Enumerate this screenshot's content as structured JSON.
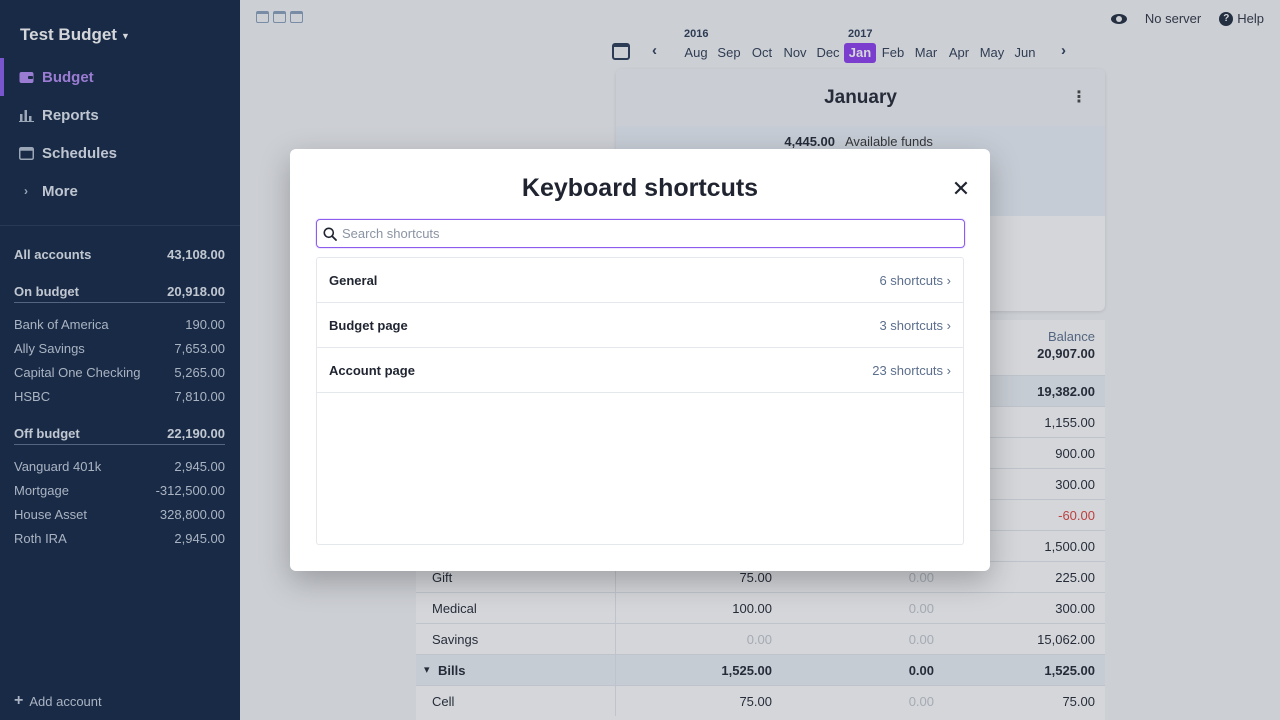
{
  "sidebar": {
    "budget_name": "Test Budget",
    "nav": [
      {
        "label": "Budget",
        "icon": "wallet-icon",
        "active": true
      },
      {
        "label": "Reports",
        "icon": "bar-chart-icon"
      },
      {
        "label": "Schedules",
        "icon": "calendar-icon"
      },
      {
        "label": "More",
        "icon": "chevron-right-icon"
      }
    ],
    "accounts": {
      "all": {
        "name": "All accounts",
        "amount": "43,108.00"
      },
      "on_budget": {
        "name": "On budget",
        "amount": "20,918.00"
      },
      "on_budget_items": [
        {
          "name": "Bank of America",
          "amount": "190.00"
        },
        {
          "name": "Ally Savings",
          "amount": "7,653.00"
        },
        {
          "name": "Capital One Checking",
          "amount": "5,265.00"
        },
        {
          "name": "HSBC",
          "amount": "7,810.00"
        }
      ],
      "off_budget": {
        "name": "Off budget",
        "amount": "22,190.00"
      },
      "off_budget_items": [
        {
          "name": "Vanguard 401k",
          "amount": "2,945.00"
        },
        {
          "name": "Mortgage",
          "amount": "-312,500.00"
        },
        {
          "name": "House Asset",
          "amount": "328,800.00"
        },
        {
          "name": "Roth IRA",
          "amount": "2,945.00"
        }
      ]
    },
    "add_account": "Add account"
  },
  "topbar": {
    "server": "No server",
    "help": "Help"
  },
  "months": {
    "year_2016": "2016",
    "year_2017": "2017",
    "labels": [
      "Aug",
      "Sep",
      "Oct",
      "Nov",
      "Dec",
      "Jan",
      "Feb",
      "Mar",
      "Apr",
      "May",
      "Jun"
    ],
    "selected_index": 5
  },
  "budget_card": {
    "title": "January",
    "available_funds_value": "4,445.00",
    "available_funds_label": "Available funds"
  },
  "table": {
    "balance_label": "Balance",
    "balance_total": "20,907.00",
    "rows": [
      {
        "name": "",
        "c1": "",
        "c2": "",
        "c3": "19,382.00",
        "group": true
      },
      {
        "name": "",
        "c1": "",
        "c2": "",
        "c3": "1,155.00"
      },
      {
        "name": "",
        "c1": "",
        "c2": "",
        "c3": "900.00"
      },
      {
        "name": "",
        "c1": "",
        "c2": "",
        "c3": "300.00"
      },
      {
        "name": "",
        "c1": "",
        "c2": "",
        "c3": "-60.00",
        "neg": true
      },
      {
        "name": "",
        "c1": "",
        "c2": "",
        "c3": "1,500.00"
      },
      {
        "name": "Gift",
        "c1": "75.00",
        "c2": "0.00",
        "c3": "225.00"
      },
      {
        "name": "Medical",
        "c1": "100.00",
        "c2": "0.00",
        "c3": "300.00"
      },
      {
        "name": "Savings",
        "c1": "0.00",
        "c2": "0.00",
        "c3": "15,062.00",
        "c1_muted": true
      },
      {
        "name": "Bills",
        "c1": "1,525.00",
        "c2": "0.00",
        "c3": "1,525.00",
        "group": true
      },
      {
        "name": "Cell",
        "c1": "75.00",
        "c2": "0.00",
        "c3": "75.00"
      }
    ]
  },
  "modal": {
    "title": "Keyboard shortcuts",
    "search_placeholder": "Search shortcuts",
    "search_value": "",
    "items": [
      {
        "label": "General",
        "count": "6 shortcuts ›"
      },
      {
        "label": "Budget page",
        "count": "3 shortcuts ›"
      },
      {
        "label": "Account page",
        "count": "23 shortcuts ›"
      }
    ]
  },
  "colors": {
    "sidebar_bg": "#0f2340",
    "accent": "#8c5bf0",
    "selected_month": "#8c3cf0",
    "negative": "#e0413a"
  }
}
